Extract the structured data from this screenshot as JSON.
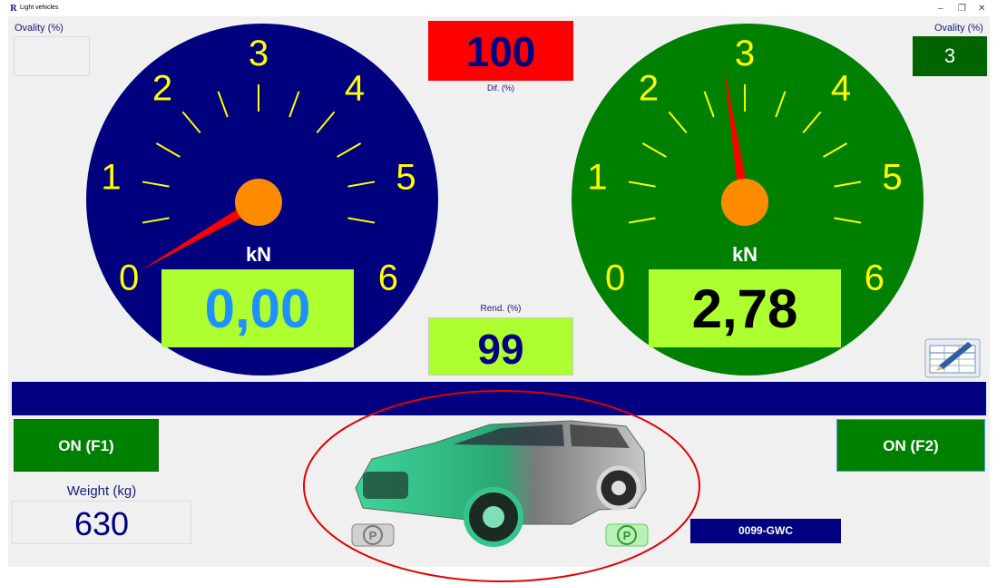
{
  "window": {
    "title": "Light vehicles",
    "app_icon": "R",
    "controls": [
      "–",
      "❐",
      "✕"
    ]
  },
  "left_gauge": {
    "ovality_label": "Ovality (%)",
    "ovality_value": "",
    "unit": "kN",
    "scale": [
      "0",
      "1",
      "2",
      "3",
      "4",
      "5",
      "6"
    ],
    "value": "0,00",
    "dial_color": "#00007f",
    "needle_value": 0.0
  },
  "right_gauge": {
    "ovality_label": "Ovality (%)",
    "ovality_value": "3",
    "unit": "kN",
    "scale": [
      "0",
      "1",
      "2",
      "3",
      "4",
      "5",
      "6"
    ],
    "value": "2,78",
    "dial_color": "#008000",
    "needle_value": 2.78
  },
  "dif": {
    "value": "100",
    "label": "Dif. (%)"
  },
  "rend": {
    "label": "Rend. (%)",
    "value": "99"
  },
  "buttons": {
    "left": "ON (F1)",
    "right": "ON (F2)"
  },
  "weight": {
    "label": "Weight (kg)",
    "value": "630"
  },
  "plate": "0099-GWC",
  "parking": {
    "left": "P",
    "right": "P"
  },
  "icons": {
    "report": "report-edit-icon",
    "car": "car-image"
  },
  "colors": {
    "accent_red": "#ff0000",
    "value_green": "#adff2f",
    "navy": "#000080",
    "button_green": "#008000",
    "hub_orange": "#ff8c00",
    "scale_yellow": "#ffff00"
  }
}
